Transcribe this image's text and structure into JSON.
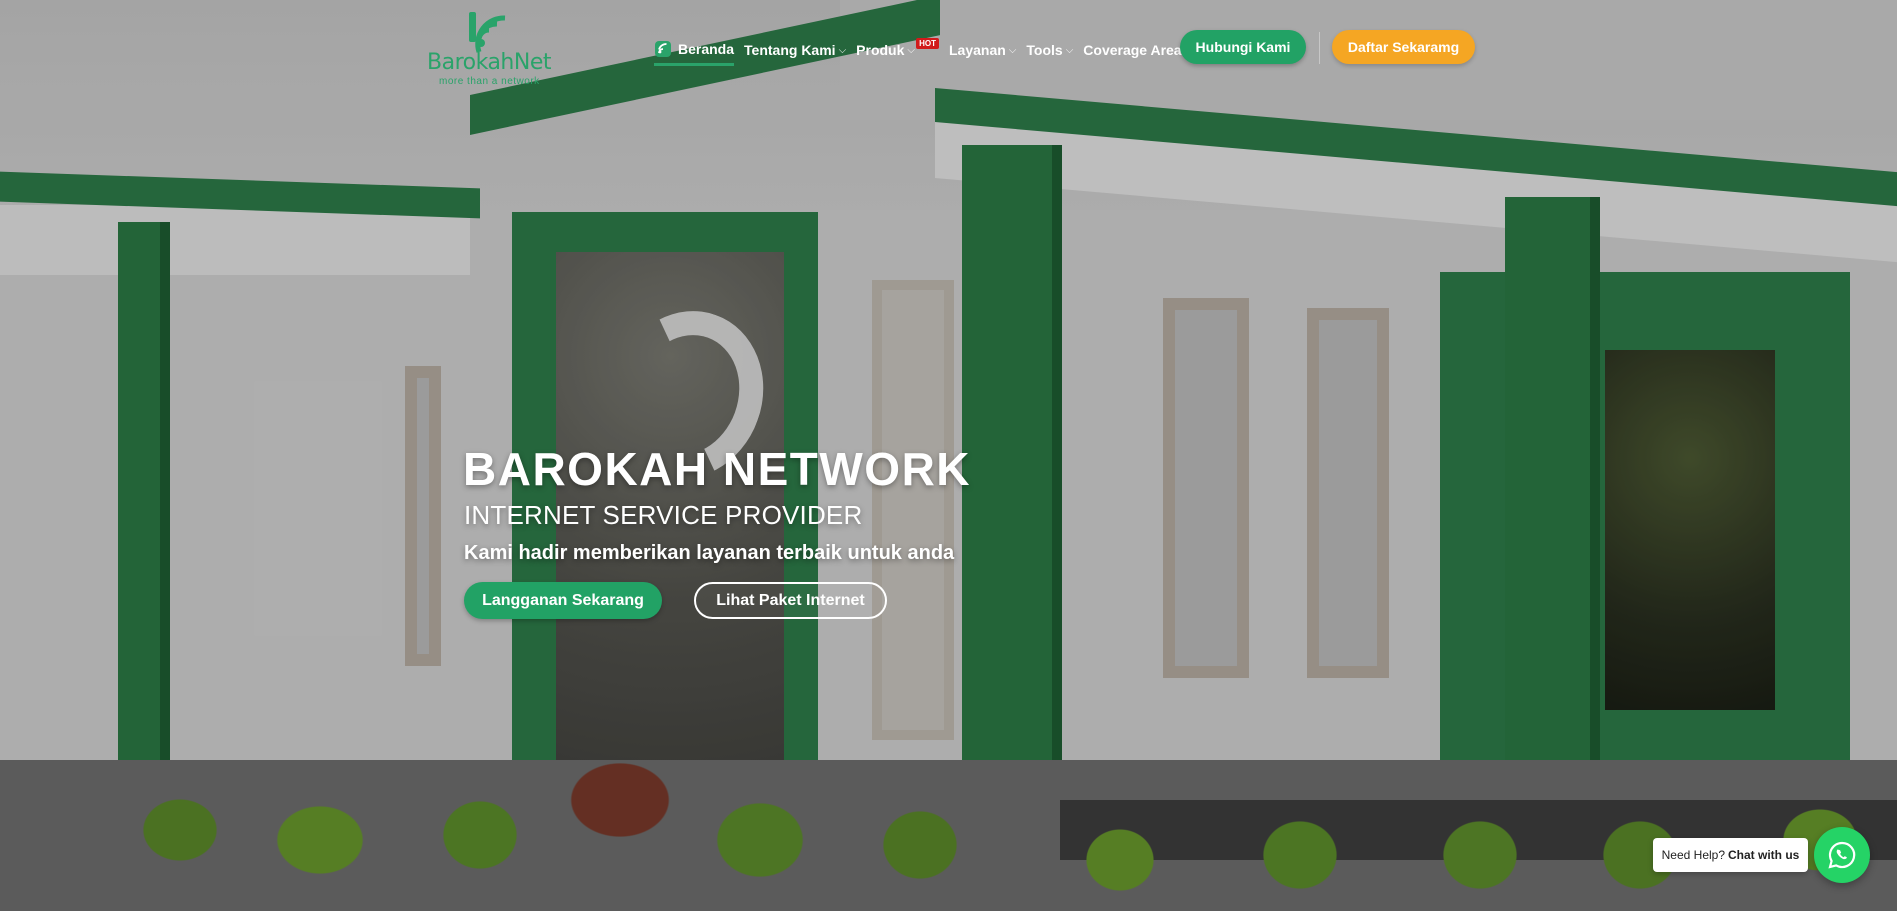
{
  "brand": {
    "name": "BarokahNet",
    "tagline": "more than a network",
    "color": "#2aa36a"
  },
  "nav": {
    "items": [
      {
        "label": "Beranda",
        "active": true,
        "dropdown": false
      },
      {
        "label": "Tentang Kami",
        "active": false,
        "dropdown": true
      },
      {
        "label": "Produk",
        "active": false,
        "dropdown": true,
        "badge": "HOT"
      },
      {
        "label": "Layanan",
        "active": false,
        "dropdown": true
      },
      {
        "label": "Tools",
        "active": false,
        "dropdown": true
      },
      {
        "label": "Coverage Area",
        "active": false,
        "dropdown": false
      }
    ],
    "contact_button": "Hubungi Kami",
    "register_button": "Daftar Sekaramg"
  },
  "hero": {
    "title": "BAROKAH NETWORK",
    "subtitle": "INTERNET SERVICE PROVIDER",
    "tagline": "Kami hadir memberikan layanan terbaik untuk anda",
    "primary_button": "Langganan Sekarang",
    "secondary_button": "Lihat Paket Internet"
  },
  "help": {
    "prefix": "Need Help?",
    "action": "Chat with us",
    "icon": "whatsapp-icon"
  },
  "colors": {
    "accent_green": "#22a265",
    "accent_orange": "#f5a623",
    "hot_red": "#d11b1b",
    "whatsapp": "#25d366"
  }
}
